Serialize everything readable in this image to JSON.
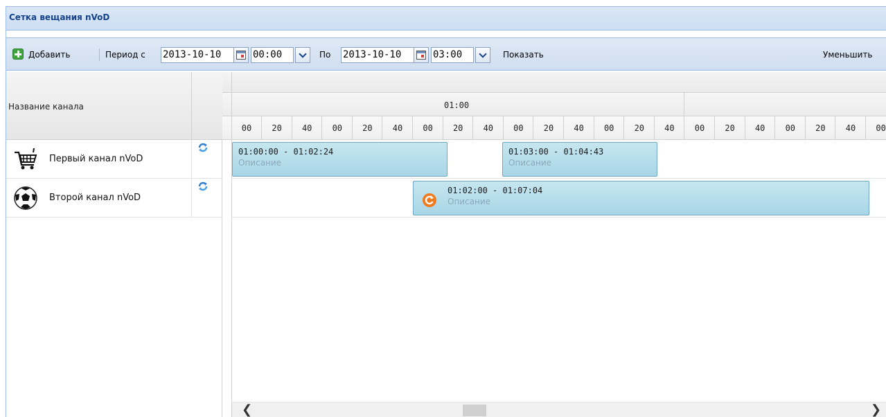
{
  "panel": {
    "title": "Сетка вещания nVoD"
  },
  "toolbar": {
    "add_label": "Добавить",
    "period_from_label": "Период с",
    "date_from": "2013-10-10",
    "time_from": "00:00",
    "to_label": "По",
    "date_to": "2013-10-10",
    "time_to": "03:00",
    "show_label": "Показать",
    "zoom_out_label": "Уменьшить"
  },
  "grid": {
    "channel_column_header": "Название канала",
    "hour_label": "01:00",
    "minute_ticks": [
      "00",
      "20",
      "40",
      "00",
      "20",
      "40",
      "00",
      "20",
      "40",
      "00",
      "20",
      "40",
      "00",
      "20",
      "40",
      "00",
      "20",
      "40",
      "00",
      "20",
      "40",
      "00"
    ]
  },
  "channels": [
    {
      "name": "Первый канал nVoD",
      "icon": "shopping-cart-icon"
    },
    {
      "name": "Второй канал nVoD",
      "icon": "soccer-ball-icon"
    }
  ],
  "events": [
    {
      "time": "01:00:00 - 01:02:24",
      "desc": "Описание"
    },
    {
      "time": "01:03:00 - 01:04:43",
      "desc": "Описание"
    },
    {
      "time": "01:02:00 - 01:07:04",
      "desc": "Описание"
    }
  ],
  "colors": {
    "accent": "#15428b",
    "event_fill": "#a8d6e6",
    "event_border": "#6fa8c4",
    "replay": "#f07a1e"
  }
}
